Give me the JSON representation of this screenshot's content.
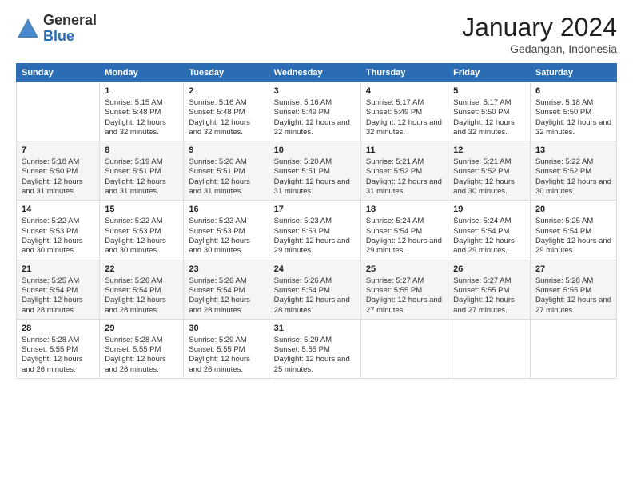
{
  "header": {
    "logo_general": "General",
    "logo_blue": "Blue",
    "month_title": "January 2024",
    "location": "Gedangan, Indonesia"
  },
  "weekdays": [
    "Sunday",
    "Monday",
    "Tuesday",
    "Wednesday",
    "Thursday",
    "Friday",
    "Saturday"
  ],
  "weeks": [
    [
      {
        "day": "",
        "sunrise": "",
        "sunset": "",
        "daylight": ""
      },
      {
        "day": "1",
        "sunrise": "5:15 AM",
        "sunset": "5:48 PM",
        "daylight": "12 hours and 32 minutes."
      },
      {
        "day": "2",
        "sunrise": "5:16 AM",
        "sunset": "5:48 PM",
        "daylight": "12 hours and 32 minutes."
      },
      {
        "day": "3",
        "sunrise": "5:16 AM",
        "sunset": "5:49 PM",
        "daylight": "12 hours and 32 minutes."
      },
      {
        "day": "4",
        "sunrise": "5:17 AM",
        "sunset": "5:49 PM",
        "daylight": "12 hours and 32 minutes."
      },
      {
        "day": "5",
        "sunrise": "5:17 AM",
        "sunset": "5:50 PM",
        "daylight": "12 hours and 32 minutes."
      },
      {
        "day": "6",
        "sunrise": "5:18 AM",
        "sunset": "5:50 PM",
        "daylight": "12 hours and 32 minutes."
      }
    ],
    [
      {
        "day": "7",
        "sunrise": "5:18 AM",
        "sunset": "5:50 PM",
        "daylight": "12 hours and 31 minutes."
      },
      {
        "day": "8",
        "sunrise": "5:19 AM",
        "sunset": "5:51 PM",
        "daylight": "12 hours and 31 minutes."
      },
      {
        "day": "9",
        "sunrise": "5:20 AM",
        "sunset": "5:51 PM",
        "daylight": "12 hours and 31 minutes."
      },
      {
        "day": "10",
        "sunrise": "5:20 AM",
        "sunset": "5:51 PM",
        "daylight": "12 hours and 31 minutes."
      },
      {
        "day": "11",
        "sunrise": "5:21 AM",
        "sunset": "5:52 PM",
        "daylight": "12 hours and 31 minutes."
      },
      {
        "day": "12",
        "sunrise": "5:21 AM",
        "sunset": "5:52 PM",
        "daylight": "12 hours and 30 minutes."
      },
      {
        "day": "13",
        "sunrise": "5:22 AM",
        "sunset": "5:52 PM",
        "daylight": "12 hours and 30 minutes."
      }
    ],
    [
      {
        "day": "14",
        "sunrise": "5:22 AM",
        "sunset": "5:53 PM",
        "daylight": "12 hours and 30 minutes."
      },
      {
        "day": "15",
        "sunrise": "5:22 AM",
        "sunset": "5:53 PM",
        "daylight": "12 hours and 30 minutes."
      },
      {
        "day": "16",
        "sunrise": "5:23 AM",
        "sunset": "5:53 PM",
        "daylight": "12 hours and 30 minutes."
      },
      {
        "day": "17",
        "sunrise": "5:23 AM",
        "sunset": "5:53 PM",
        "daylight": "12 hours and 29 minutes."
      },
      {
        "day": "18",
        "sunrise": "5:24 AM",
        "sunset": "5:54 PM",
        "daylight": "12 hours and 29 minutes."
      },
      {
        "day": "19",
        "sunrise": "5:24 AM",
        "sunset": "5:54 PM",
        "daylight": "12 hours and 29 minutes."
      },
      {
        "day": "20",
        "sunrise": "5:25 AM",
        "sunset": "5:54 PM",
        "daylight": "12 hours and 29 minutes."
      }
    ],
    [
      {
        "day": "21",
        "sunrise": "5:25 AM",
        "sunset": "5:54 PM",
        "daylight": "12 hours and 28 minutes."
      },
      {
        "day": "22",
        "sunrise": "5:26 AM",
        "sunset": "5:54 PM",
        "daylight": "12 hours and 28 minutes."
      },
      {
        "day": "23",
        "sunrise": "5:26 AM",
        "sunset": "5:54 PM",
        "daylight": "12 hours and 28 minutes."
      },
      {
        "day": "24",
        "sunrise": "5:26 AM",
        "sunset": "5:54 PM",
        "daylight": "12 hours and 28 minutes."
      },
      {
        "day": "25",
        "sunrise": "5:27 AM",
        "sunset": "5:55 PM",
        "daylight": "12 hours and 27 minutes."
      },
      {
        "day": "26",
        "sunrise": "5:27 AM",
        "sunset": "5:55 PM",
        "daylight": "12 hours and 27 minutes."
      },
      {
        "day": "27",
        "sunrise": "5:28 AM",
        "sunset": "5:55 PM",
        "daylight": "12 hours and 27 minutes."
      }
    ],
    [
      {
        "day": "28",
        "sunrise": "5:28 AM",
        "sunset": "5:55 PM",
        "daylight": "12 hours and 26 minutes."
      },
      {
        "day": "29",
        "sunrise": "5:28 AM",
        "sunset": "5:55 PM",
        "daylight": "12 hours and 26 minutes."
      },
      {
        "day": "30",
        "sunrise": "5:29 AM",
        "sunset": "5:55 PM",
        "daylight": "12 hours and 26 minutes."
      },
      {
        "day": "31",
        "sunrise": "5:29 AM",
        "sunset": "5:55 PM",
        "daylight": "12 hours and 25 minutes."
      },
      {
        "day": "",
        "sunrise": "",
        "sunset": "",
        "daylight": ""
      },
      {
        "day": "",
        "sunrise": "",
        "sunset": "",
        "daylight": ""
      },
      {
        "day": "",
        "sunrise": "",
        "sunset": "",
        "daylight": ""
      }
    ]
  ]
}
